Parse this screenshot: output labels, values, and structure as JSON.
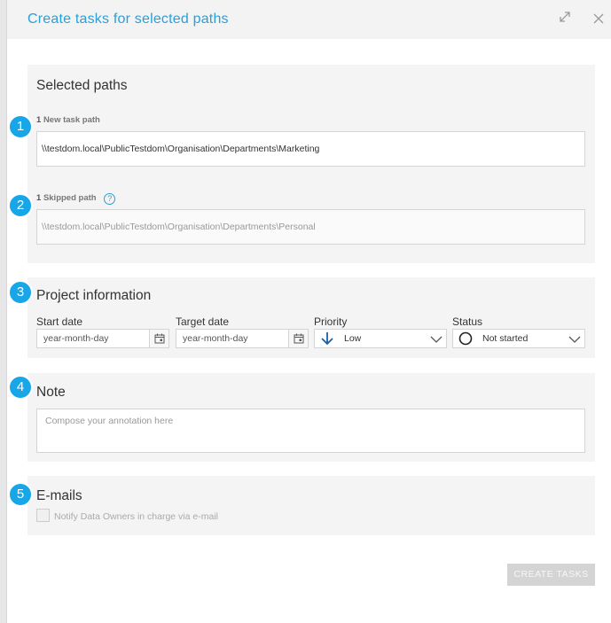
{
  "dialog": {
    "title": "Create tasks for selected paths"
  },
  "badges": [
    "1",
    "2",
    "3",
    "4",
    "5"
  ],
  "selected_paths": {
    "title": "Selected paths",
    "new_task": {
      "count": "1",
      "label": "New task path",
      "value": "\\\\testdom.local\\PublicTestdom\\Organisation\\Departments\\Marketing"
    },
    "skipped": {
      "count": "1",
      "label": "Skipped path",
      "help": "?",
      "value": "\\\\testdom.local\\PublicTestdom\\Organisation\\Departments\\Personal"
    }
  },
  "project_info": {
    "title": "Project information",
    "start_date": {
      "label": "Start date",
      "placeholder": "year-month-day"
    },
    "target_date": {
      "label": "Target date",
      "placeholder": "year-month-day"
    },
    "priority": {
      "label": "Priority",
      "value": "Low",
      "icon": "arrow-down-icon"
    },
    "status": {
      "label": "Status",
      "value": "Not started",
      "icon": "circle-icon"
    }
  },
  "note": {
    "title": "Note",
    "placeholder": "Compose your annotation here"
  },
  "emails": {
    "title": "E-mails",
    "notify_label": "Notify Data Owners in charge via e-mail",
    "checked": false
  },
  "actions": {
    "create_label": "CREATE TASKS"
  },
  "colors": {
    "accent": "#2a9fd8",
    "badge": "#17a7e8",
    "section_bg": "#f4f4f4",
    "disabled_button": "#d4d4d4"
  }
}
